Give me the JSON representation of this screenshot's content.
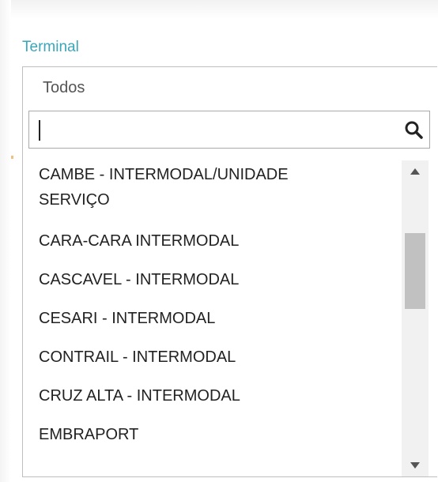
{
  "field": {
    "label": "Terminal",
    "selected_value": "Todos"
  },
  "search": {
    "value": "",
    "placeholder": "",
    "icon": "search-icon"
  },
  "options": [
    {
      "label_line1": "CAMBE - INTERMODAL/UNIDADE",
      "label_line2": "SERVIÇO"
    },
    {
      "label_line1": "CARA-CARA INTERMODAL"
    },
    {
      "label_line1": "CASCAVEL - INTERMODAL"
    },
    {
      "label_line1": "CESARI - INTERMODAL"
    },
    {
      "label_line1": "CONTRAIL - INTERMODAL"
    },
    {
      "label_line1": "CRUZ ALTA - INTERMODAL"
    },
    {
      "label_line1": "EMBRAPORT"
    }
  ],
  "colors": {
    "label": "#3aa6b9",
    "border": "#bfbfbf",
    "scroll_thumb": "#c1c1c1",
    "scroll_track": "#f1f1f1"
  }
}
